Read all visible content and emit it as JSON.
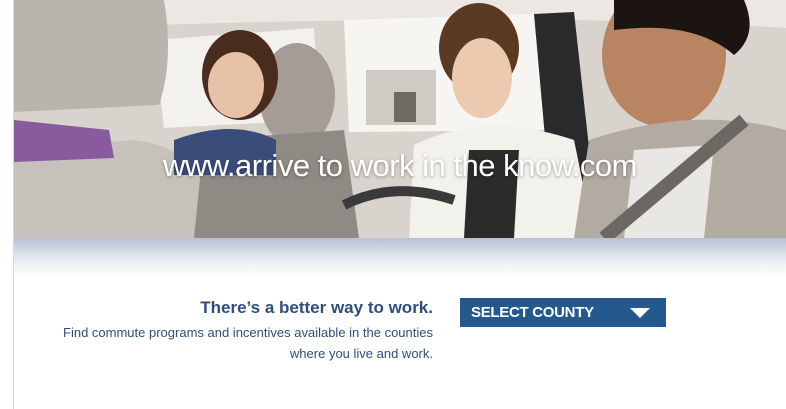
{
  "hero": {
    "tagline": "www.arrive to work in the know.com",
    "image": "three-people-in-car-photo"
  },
  "cta": {
    "headline": "There’s a better way to work.",
    "body": "Find commute programs and incentives available in the counties where you live and work."
  },
  "county_select": {
    "label": "SELECT COUNTY",
    "icon": "triangle-down-icon"
  },
  "colors": {
    "accent": "#24598d",
    "text": "#2f4e7e",
    "band": "#b6c1d2"
  }
}
